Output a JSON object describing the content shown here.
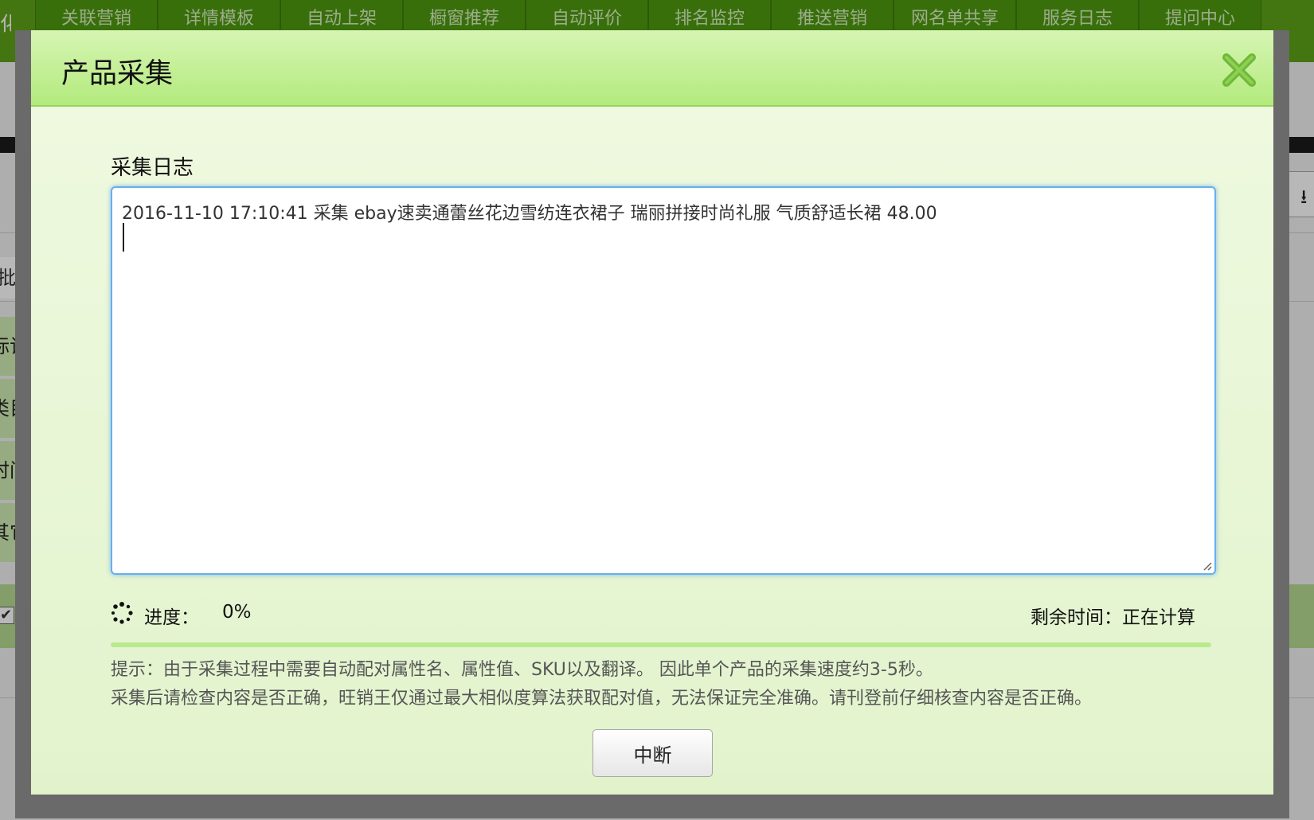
{
  "background": {
    "nav_edge_label": "化",
    "nav_tabs": [
      "关联营销",
      "详情模板",
      "自动上架",
      "橱窗推荐",
      "自动评价",
      "排名监控",
      "推送营销",
      "网名单共享",
      "服务日志",
      "提问中心"
    ],
    "batch_label": "批",
    "side_labels": [
      "标记",
      "类目",
      "时间",
      "其它"
    ],
    "download_icon": "download-icon"
  },
  "modal": {
    "title": "产品采集",
    "close_icon": "close-icon",
    "log_label": "采集日志",
    "log_lines": [
      "2016-11-10 17:10:41 采集 ebay速卖通蕾丝花边雪纺连衣裙子 瑞丽拼接时尚礼服 气质舒适长裙 48.00"
    ],
    "progress_label": "进度：",
    "progress_value": "0%",
    "progress_fraction": 0,
    "remaining_label": "剩余时间：正在计算",
    "tip_lines": [
      "提示：由于采集过程中需要自动配对属性名、属性值、SKU以及翻译。 因此单个产品的采集速度约3-5秒。",
      "采集后请检查内容是否正确，旺销王仅通过最大相似度算法获取配对值，无法保证完全准确。请刊登前仔细核查内容是否正确。"
    ],
    "abort_button": "中断",
    "spinner_icon": "spinner-icon"
  },
  "colors": {
    "nav_green": "#5ea318",
    "header_green": "#b3ea7d",
    "body_green": "#e6f4d2",
    "close_icon": "#6fb83a",
    "input_focus": "#66aff0"
  }
}
